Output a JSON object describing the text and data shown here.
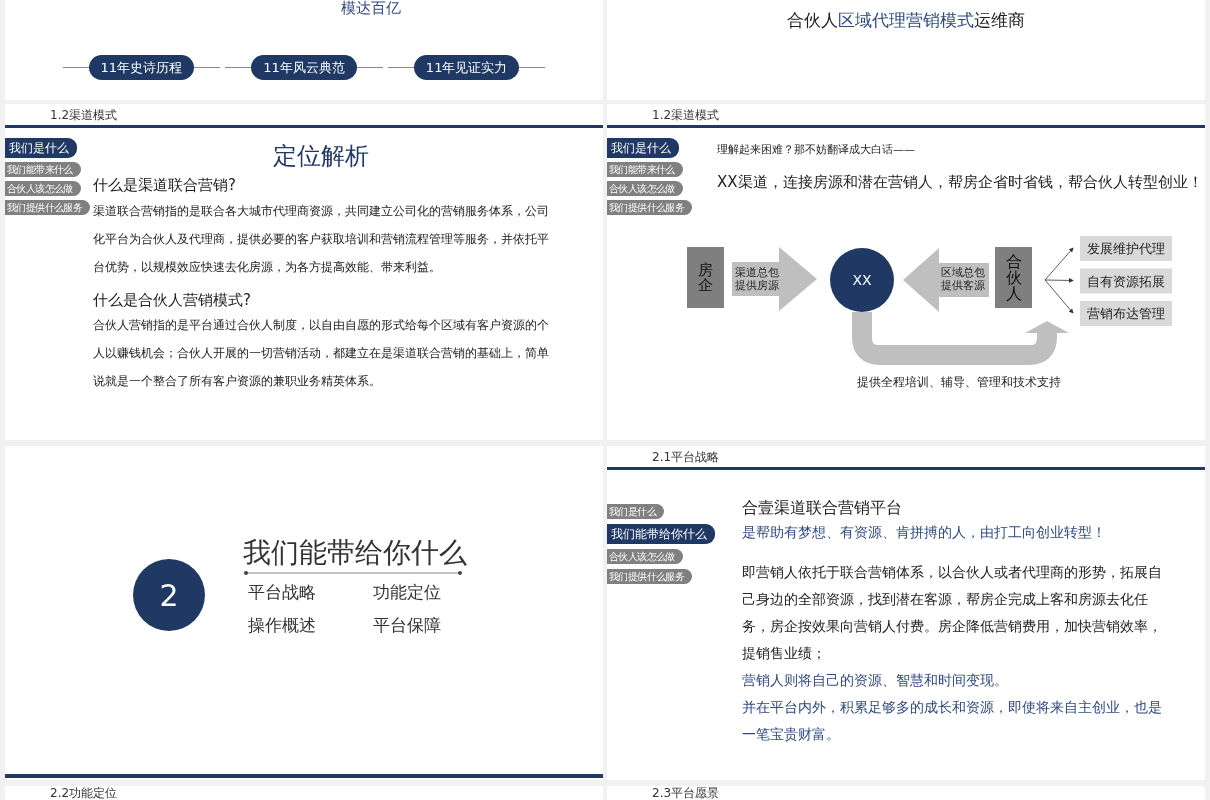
{
  "columns": [
    {
      "slides": [
        {
          "kind": "timeline",
          "caption": "模达百亿",
          "pills": [
            "11年史诗历程",
            "11年风云典范",
            "11年见证实力"
          ]
        },
        {
          "kind": "text",
          "section": "1.2渠道模式",
          "nav": [
            {
              "label": "我们是什么",
              "selected": true
            },
            {
              "label": "我们能带来什么",
              "selected": false
            },
            {
              "label": "合伙人该怎么做",
              "selected": false
            },
            {
              "label": "我们提供什么服务",
              "selected": false
            }
          ],
          "title": "定位解析",
          "blocks": [
            {
              "heading": "什么是渠道联合营销?",
              "body": "渠道联合营销指的是联合各大城市代理商资源，共同建立公司化的营销服务体系，公司化平台为合伙人及代理商，提供必要的客户获取培训和营销流程管理等服务，并依托平台优势，以规模效应快速去化房源，为各方提高效能、带来利益。"
            },
            {
              "heading": "什么是合伙人营销模式?",
              "body": "合伙人营销指的是平台通过合伙人制度，以自由自愿的形式给每个区域有客户资源的个人以赚钱机会；合伙人开展的一切营销活动，都建立在是渠道联合营销的基础上，简单说就是一个整合了所有客户资源的兼职业务精英体系。"
            }
          ]
        },
        {
          "kind": "chapter",
          "number": "2",
          "title": "我们能带给你什么",
          "topics": [
            "平台战略",
            "功能定位",
            "操作概述",
            "平台保障"
          ]
        },
        {
          "kind": "stub",
          "section": "2.2功能定位"
        }
      ]
    },
    {
      "slides": [
        {
          "kind": "banner",
          "title_parts": [
            {
              "text": "合伙人",
              "highlighted": false
            },
            {
              "text": "区域代理营销模式",
              "highlighted": true
            },
            {
              "text": "运维商",
              "highlighted": false
            }
          ]
        },
        {
          "kind": "diagram",
          "section": "1.2渠道模式",
          "nav": [
            {
              "label": "我们是什么",
              "selected": true
            },
            {
              "label": "我们能带来什么",
              "selected": false
            },
            {
              "label": "合伙人该怎么做",
              "selected": false
            },
            {
              "label": "我们提供什么服务",
              "selected": false
            }
          ],
          "intro": "理解起来困难？那不妨翻译成大白话——",
          "slogan": "XX渠道，连接房源和潜在营销人，帮房企省时省钱，帮合伙人转型创业！",
          "diagram": {
            "source": "房企",
            "source_arrow": [
              "渠道总包",
              "提供房源"
            ],
            "hub": "XX",
            "partner_arrow": [
              "区域总包",
              "提供客源"
            ],
            "partner": "合伙人",
            "outputs": [
              "发展维护代理",
              "自有资源拓展",
              "营销布达管理"
            ],
            "support": "提供全程培训、辅导、管理和技术支持"
          }
        },
        {
          "kind": "platform",
          "section": "2.1平台战略",
          "nav": [
            {
              "label": "我们是什么",
              "selected": false
            },
            {
              "label": "我们能带给你什么",
              "selected": true
            },
            {
              "label": "合伙人该怎么做",
              "selected": false
            },
            {
              "label": "我们提供什么服务",
              "selected": false
            }
          ],
          "title": "合壹渠道联合营销平台",
          "subtitle": "是帮助有梦想、有资源、肯拼搏的人，由打工向创业转型！",
          "paragraphs": [
            {
              "text": "即营销人依托于联合营销体系，以合伙人或者代理商的形势，拓展自己身边的全部资源，找到潜在客源，帮房企完成上客和房源去化任务，房企按效果向营销人付费。房企降低营销费用，加快营销效率，提销售业绩；",
              "highlighted": false
            },
            {
              "text": "营销人则将自己的资源、智慧和时间变现。",
              "highlighted": true
            },
            {
              "text": "并在平台内外，积累足够多的成长和资源，即使将来自主创业，也是一笔宝贵财富。",
              "highlighted": true
            }
          ]
        },
        {
          "kind": "stub",
          "section": "2.3平台愿景"
        }
      ]
    }
  ]
}
